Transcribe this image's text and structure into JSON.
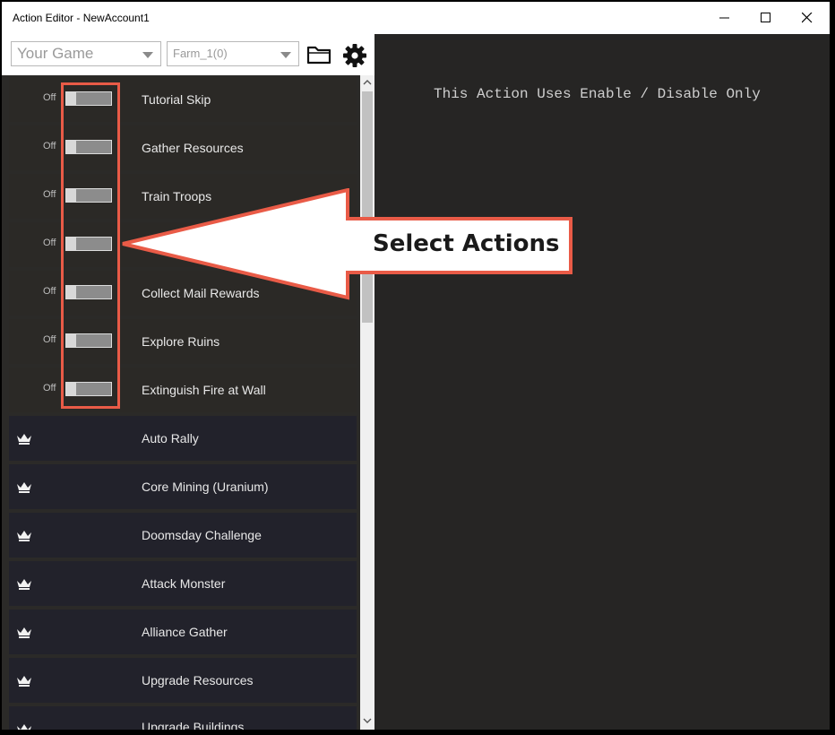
{
  "window": {
    "title": "Action Editor - NewAccount1"
  },
  "toolbar": {
    "game_select": "Your Game",
    "farm_select": "Farm_1(0)",
    "folder_icon": "folder-icon",
    "settings_icon": "gear-icon"
  },
  "actions": [
    {
      "label": "Tutorial Skip",
      "state": "Off"
    },
    {
      "label": "Gather Resources",
      "state": "Off"
    },
    {
      "label": "Train Troops",
      "state": "Off"
    },
    {
      "label": "",
      "state": "Off"
    },
    {
      "label": "Collect Mail Rewards",
      "state": "Off"
    },
    {
      "label": "Explore Ruins",
      "state": "Off"
    },
    {
      "label": "Extinguish Fire at Wall",
      "state": "Off"
    }
  ],
  "premium_actions": [
    "Auto Rally",
    "Core Mining (Uranium)",
    "Doomsday Challenge",
    "Attack Monster",
    "Alliance Gather",
    "Upgrade Resources",
    "Upgrade Buildings"
  ],
  "right_panel": {
    "info": "This Action Uses Enable / Disable Only"
  },
  "annotation": {
    "callout_text": "Select Actions",
    "color": "#e95b47"
  },
  "colors": {
    "toggle_off": "#8c8c8c",
    "list_row": "#2b2926",
    "premium_row": "#22222b"
  }
}
